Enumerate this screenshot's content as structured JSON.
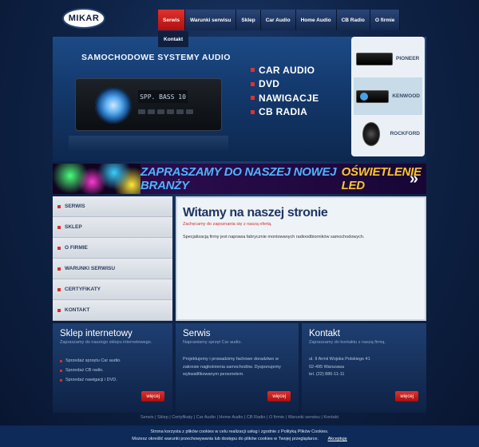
{
  "logo": "MIKAR",
  "nav": {
    "items": [
      "Serwis",
      "Warunki serwisu",
      "Sklep",
      "Car Audio",
      "Home Audio",
      "CB Radio",
      "O firmie"
    ],
    "sub": "Kontakt"
  },
  "hero": {
    "title": "SAMOCHODOWE SYSTEMY AUDIO",
    "radio_display": "SPP. BASS 10",
    "list": [
      "CAR AUDIO",
      "DVD",
      "NAWIGACJE",
      "CB RADIA"
    ],
    "brands": [
      "PIONEER",
      "KENWOOD",
      "ROCKFORD"
    ]
  },
  "banner": {
    "text_white": "ZAPRASZAMY DO NASZEJ NOWEJ BRANŻY",
    "text_yellow": "OŚWIETLENIE LED",
    "arrow": "»"
  },
  "sidebar": {
    "items": [
      "SERWIS",
      "SKLEP",
      "O FIRMIE",
      "WARUNKI SERWISU",
      "CERTYFIKATY",
      "KONTAKT"
    ]
  },
  "main": {
    "title": "Witamy na naszej stronie",
    "lead": "Zachęcamy do zapoznania się z naszą ofertą.",
    "body": "Specjalizacją firmy jest naprawa fabrycznie montowanych radioodbiorników samochodowych."
  },
  "boxes": {
    "shop": {
      "title": "Sklep internetowy",
      "sub": "Zapraszamy do naszego sklepu internetowego.",
      "items": [
        "Sprzedaż sprzętu Car audio.",
        "Sprzedaż CB radio.",
        "Sprzedaż nawigacji i DVD."
      ],
      "more": "więcej"
    },
    "service": {
      "title": "Serwis",
      "sub": "Naprawiamy sprzęt Car audio.",
      "text": "Projektujemy i prowadzimy fachowe doradztwo w zakresie nagłośnienia samochodów. Dysponujemy wykwalifikowanym personelem.",
      "more": "więcej"
    },
    "contact": {
      "title": "Kontakt",
      "sub": "Zapraszamy do kontaktu z naszą firmą.",
      "lines": [
        "ul. II Armii Wojska Polskiego 41",
        "02-495 Warszawa",
        "tel. (22) 886-11-11"
      ],
      "more": "więcej"
    }
  },
  "footer": {
    "links": [
      "Serwis",
      "Sklep",
      "Certyfikaty",
      "Car Audio",
      "Home Audio",
      "CB Radio",
      "O firmie",
      "Warunki serwisu",
      "Kontakt"
    ],
    "separator": " | "
  },
  "cookie": {
    "line1": "Strona korzysta z plików cookies w celu realizacji usług i zgodnie z Polityką Plików Cookies.",
    "line2": "Możesz określić warunki przechowywania lub dostępu do plików cookies w Twojej przeglądarce.",
    "accept": "Akceptuję"
  }
}
